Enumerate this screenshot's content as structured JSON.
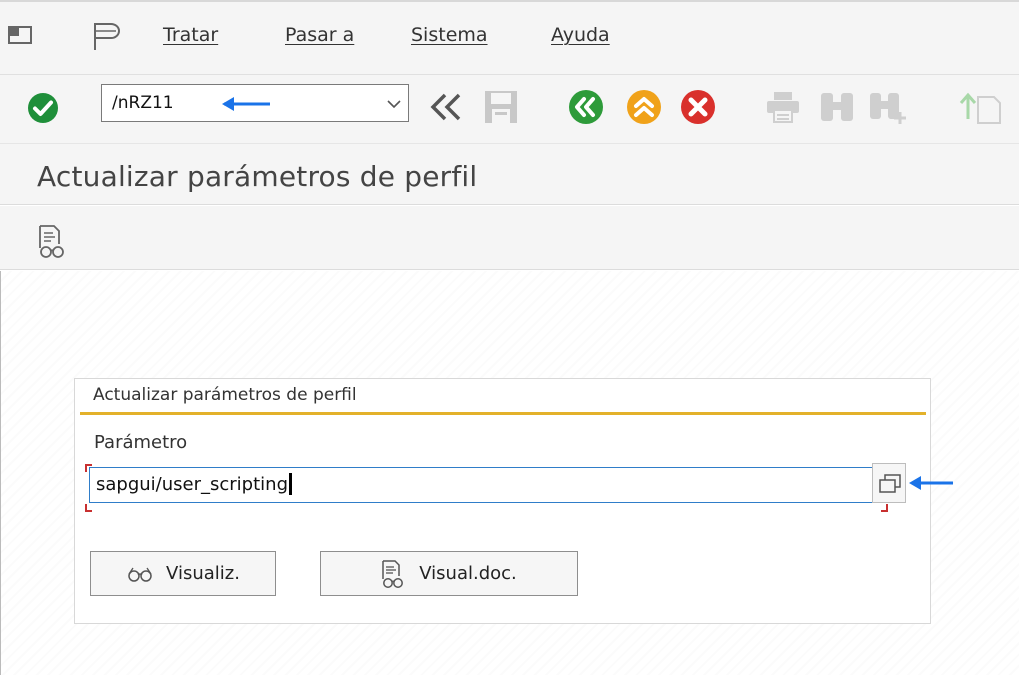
{
  "menubar": {
    "items": [
      {
        "label": "Tratar"
      },
      {
        "label": "Pasar a"
      },
      {
        "label": "Sistema"
      },
      {
        "label": "Ayuda"
      }
    ]
  },
  "toolbar": {
    "command_value": "/nRZ11"
  },
  "page": {
    "title": "Actualizar parámetros de perfil"
  },
  "group": {
    "title": "Actualizar parámetros de perfil",
    "param_label": "Parámetro",
    "param_value": "sapgui/user_scripting",
    "buttons": {
      "display": "Visualiz.",
      "display_doc": "Visual.doc."
    }
  },
  "colors": {
    "accent_line": "#e3b12a",
    "arrow": "#1a73e8",
    "ok_green": "#1f8f3a",
    "back_green": "#2e9b3a",
    "exit_orange": "#f0a21a",
    "cancel_red": "#d9302c",
    "input_focus": "#2f7dc9"
  }
}
